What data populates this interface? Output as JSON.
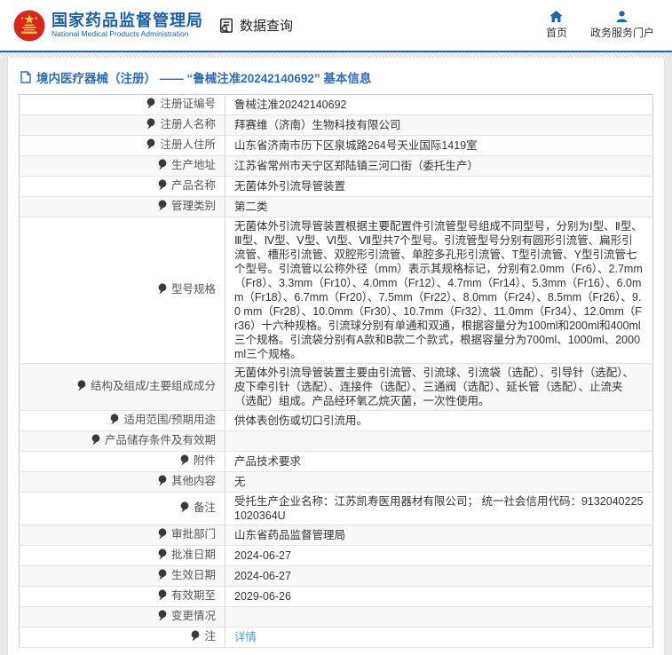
{
  "colors": {
    "brand_blue": "#1b5fa9",
    "nav_icon_blue": "#2063ae",
    "link_blue": "#4f9cd9",
    "emblem_red": "#d7261d",
    "emblem_gold": "#f9d64a"
  },
  "header": {
    "title_cn": "国家药品监督管理局",
    "title_en": "National Medical Products Administration",
    "data_query_label": "数据查询",
    "home_label": "首页",
    "portal_label": "政务服务门户"
  },
  "breadcrumb": {
    "text": "境内医疗器械（注册） —— “鲁械注准20242140692” 基本信息"
  },
  "table": {
    "rows": [
      {
        "label": "注册证编号",
        "value": "鲁械注准20242140692"
      },
      {
        "label": "注册人名称",
        "value": "拜赛维（济南）生物科技有限公司"
      },
      {
        "label": "注册人住所",
        "value": "山东省济南市历下区泉城路264号天业国际1419室"
      },
      {
        "label": "生产地址",
        "value": "江苏省常州市天宁区郑陆镇三河口街（委托生产）"
      },
      {
        "label": "产品名称",
        "value": "无菌体外引流导管装置"
      },
      {
        "label": "管理类别",
        "value": "第二类"
      },
      {
        "label": "型号规格",
        "value": "无菌体外引流导管装置根据主要配置件引流管型号组成不同型号，分别为Ⅰ型、Ⅱ型、Ⅲ型、Ⅳ型、Ⅴ型、Ⅵ型、Ⅶ型共7个型号。引流管型号分别有圆形引流管、扁形引流管、槽形引流管、双腔形引流管、单腔多孔形引流管、T型引流管、Y型引流管七个型号。引流管以公称外径（mm）表示其规格标记，分别有2.0mm（Fr6）、2.7mm（Fr8）、3.3mm（Fr10）、4.0mm（Fr12）、4.7mm（Fr14）、5.3mm（Fr16）、6.0mm（Fr18）、6.7mm（Fr20）、7.5mm（Fr22）、8.0mm（Fr24）、8.5mm（Fr26）、9.0 mm（Fr28）、10.0mm（Fr30）、10.7mm（Fr32）、11.0mm（Fr34）、12.0mm（Fr36）十六种规格。引流球分别有单通和双通，根据容量分为100ml和200ml和400ml三个规格。引流袋分别有A款和B款二个款式，根据容量分为700ml、1000ml、2000ml三个规格。"
      },
      {
        "label": "结构及组成/主要组成成分",
        "value": "无菌体外引流导管装置主要由引流管、引流球、引流袋（选配）、引导针（选配）、皮下牵引针（选配）、连接件（选配）、三通阀（选配）、延长管（选配）、止流夹（选配）组成。产品经环氧乙烷灭菌，一次性使用。"
      },
      {
        "label": "适用范围/预期用途",
        "value": "供体表创伤或切口引流用。"
      },
      {
        "label": "产品储存条件及有效期",
        "value": ""
      },
      {
        "label": "附件",
        "value": "产品技术要求"
      },
      {
        "label": "其他内容",
        "value": "无"
      },
      {
        "label": "备注",
        "value": "受托生产企业名称：江苏凯寿医用器材有限公司； 统一社会信用代码：91320402251020364U"
      },
      {
        "label": "审批部门",
        "value": "山东省药品监督管理局"
      },
      {
        "label": "批准日期",
        "value": "2024-06-27"
      },
      {
        "label": "生效日期",
        "value": "2024-06-27"
      },
      {
        "label": "有效期至",
        "value": "2029-06-26"
      },
      {
        "label": "变更情况",
        "value": ""
      },
      {
        "label": "注",
        "value": "详情",
        "link": true,
        "icon": "note-balloon-icon"
      }
    ]
  }
}
